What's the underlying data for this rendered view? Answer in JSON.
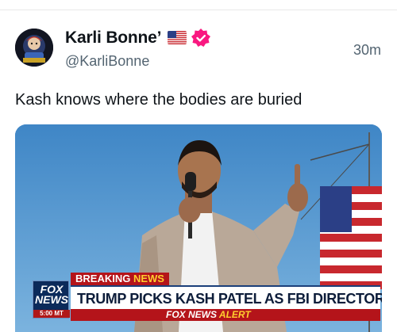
{
  "post": {
    "author_name": "Karli Bonne’",
    "handle": "@KarliBonne",
    "timestamp": "30m",
    "text": "Kash knows where the bodies are buried",
    "avatar_icon": "avatar-cartoon-icon",
    "flag_icon": "us-flag-icon",
    "verified_icon": "verified-badge-icon",
    "verified_color": "#f91880"
  },
  "media": {
    "breaking_label": "BREAKING",
    "breaking_word": "NEWS",
    "headline": "TRUMP PICKS KASH PATEL AS FBI DIRECTOR",
    "network_logo": "FOX NEWS",
    "logo_time": "5:00 MT",
    "alert_prefix": "FOX NEWS",
    "alert_word": "ALERT"
  }
}
